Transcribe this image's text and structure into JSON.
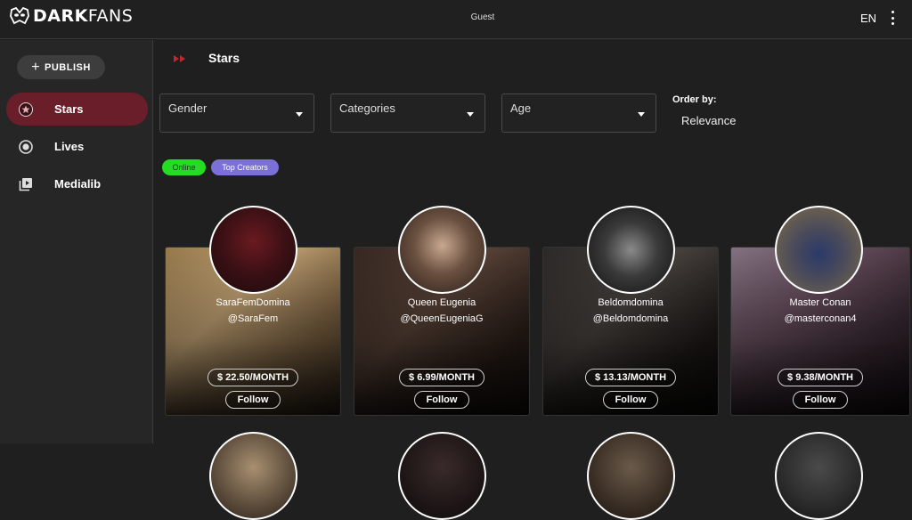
{
  "header": {
    "logo_bold": "DARK",
    "logo_light": "FANS",
    "user_label": "Guest",
    "language": "EN"
  },
  "sidebar": {
    "publish_label": "PUBLISH",
    "items": [
      {
        "label": "Stars",
        "icon": "star-circle-icon",
        "active": true
      },
      {
        "label": "Lives",
        "icon": "radio-dot-icon",
        "active": false
      },
      {
        "label": "Medialib",
        "icon": "media-library-icon",
        "active": false
      }
    ]
  },
  "main": {
    "title": "Stars",
    "filters": [
      {
        "label": "Gender"
      },
      {
        "label": "Categories"
      },
      {
        "label": "Age"
      }
    ],
    "order_by": {
      "label": "Order by:",
      "value": "Relevance"
    },
    "chips": [
      {
        "label": "Online",
        "color": "#22dd22"
      },
      {
        "label": "Top Creators",
        "color": "#7b6fd8"
      }
    ],
    "cards": [
      {
        "name": "SaraFemDomina",
        "handle": "@SaraFem",
        "price": "$ 22.50/MONTH",
        "follow": "Follow"
      },
      {
        "name": "Queen Eugenia",
        "handle": "@QueenEugeniaG",
        "price": "$ 6.99/MONTH",
        "follow": "Follow"
      },
      {
        "name": "Beldomdomina",
        "handle": "@Beldomdomina",
        "price": "$ 13.13/MONTH",
        "follow": "Follow"
      },
      {
        "name": "Master Conan",
        "handle": "@masterconan4",
        "price": "$ 9.38/MONTH",
        "follow": "Follow"
      }
    ]
  },
  "colors": {
    "accent": "#6a1e2a",
    "background": "#1f1f1f",
    "sidebar": "#262626"
  }
}
